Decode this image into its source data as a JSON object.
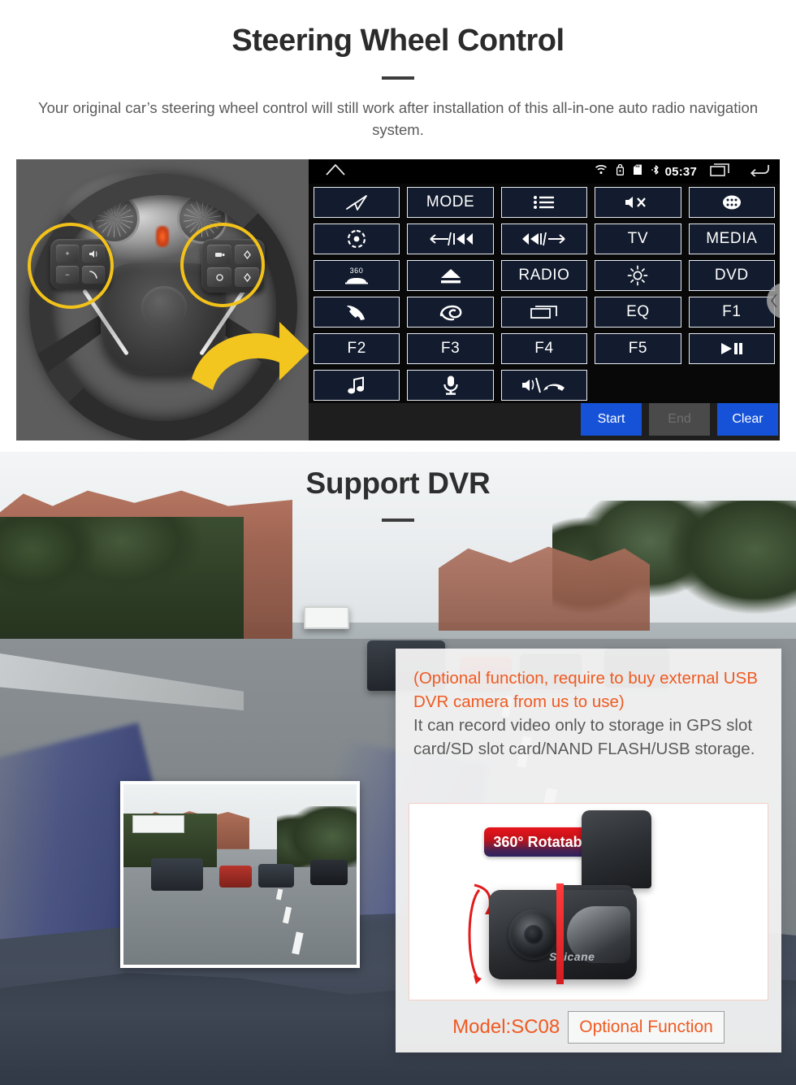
{
  "section1": {
    "title": "Steering Wheel Control",
    "subtitle": "Your original car’s steering wheel control will still work after installation of this all-in-one auto radio navigation system.",
    "steering_photo": {
      "name": "steering-wheel-photo",
      "highlight_color": "#f2c21b",
      "arrow_color": "#f3c61f",
      "left_pad_buttons": [
        "+",
        "−",
        "voice",
        "call"
      ],
      "right_pad_buttons": [
        "mode",
        "up",
        "enter",
        "down"
      ]
    },
    "head_unit": {
      "status_bar": {
        "home_icon": "home-icon",
        "icons": [
          "wifi-icon",
          "usb-lock-icon",
          "sd-card-icon",
          "bluetooth-icon"
        ],
        "clock": "05:37",
        "recents_icon": "recents-icon",
        "back_icon": "back-icon"
      },
      "keys": [
        {
          "label": "",
          "icon": "navigation-arrow-icon"
        },
        {
          "label": "MODE",
          "icon": ""
        },
        {
          "label": "",
          "icon": "list-menu-icon"
        },
        {
          "label": "",
          "icon": "mute-icon"
        },
        {
          "label": "",
          "icon": "apps-grid-icon"
        },
        {
          "label": "",
          "icon": "power-eye-icon"
        },
        {
          "label": "",
          "icon": "prev-track-icon"
        },
        {
          "label": "",
          "icon": "next-track-icon"
        },
        {
          "label": "TV",
          "icon": ""
        },
        {
          "label": "MEDIA",
          "icon": ""
        },
        {
          "label": "",
          "icon": "360-camera-icon"
        },
        {
          "label": "",
          "icon": "eject-icon"
        },
        {
          "label": "RADIO",
          "icon": ""
        },
        {
          "label": "",
          "icon": "brightness-icon"
        },
        {
          "label": "DVD",
          "icon": ""
        },
        {
          "label": "",
          "icon": "phone-icon"
        },
        {
          "label": "",
          "icon": "swirl-icon"
        },
        {
          "label": "",
          "icon": "screen-icon"
        },
        {
          "label": "EQ",
          "icon": ""
        },
        {
          "label": "F1",
          "icon": ""
        },
        {
          "label": "F2",
          "icon": ""
        },
        {
          "label": "F3",
          "icon": ""
        },
        {
          "label": "F4",
          "icon": ""
        },
        {
          "label": "F5",
          "icon": ""
        },
        {
          "label": "",
          "icon": "play-pause-icon"
        },
        {
          "label": "",
          "icon": "music-note-icon"
        },
        {
          "label": "",
          "icon": "microphone-icon"
        },
        {
          "label": "",
          "icon": "volume-hangup-icon"
        }
      ],
      "actions": {
        "start": "Start",
        "end": "End",
        "clear": "Clear",
        "primary_color": "#1652d8",
        "disabled_color": "#4a4a4a"
      },
      "edge_tab_icon": "chevron-left-icon"
    }
  },
  "section2": {
    "title": "Support DVR",
    "preview_name": "dvr-recorded-video-preview",
    "panel": {
      "note_orange": "(Optional function, require to buy external USB DVR camera from us to use)",
      "note_gray": "It can record video only to storage in GPS slot card/SD slot card/NAND FLASH/USB storage.",
      "orange_color": "#ef5a21",
      "gray_color": "#5b5b5b",
      "camera_card": {
        "badge": "360° Rotatable",
        "brand": "Seicane",
        "rotation_arrow": "rotation-arrows-icon"
      },
      "model_label": "Model:SC08",
      "optional_label": "Optional Function"
    }
  }
}
